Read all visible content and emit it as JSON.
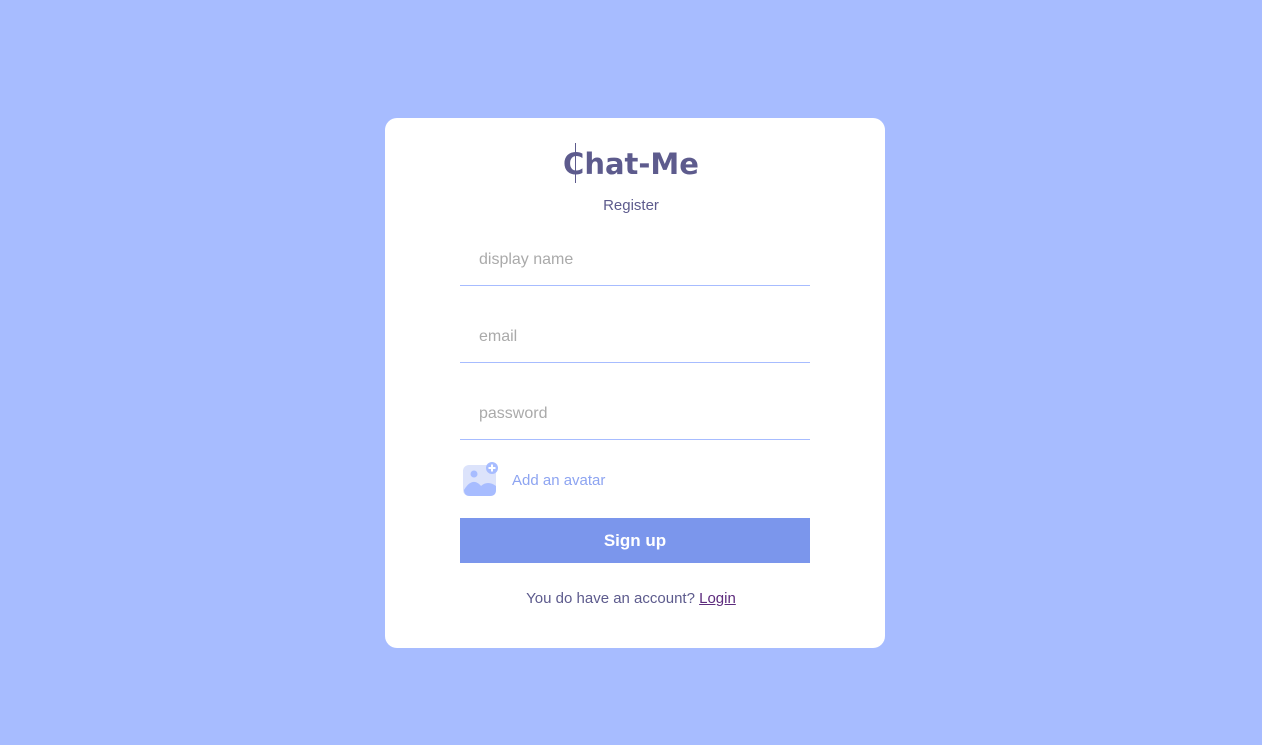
{
  "app": {
    "logo": "Chat-Me",
    "subtitle": "Register"
  },
  "form": {
    "display_name": {
      "placeholder": "display name",
      "value": ""
    },
    "email": {
      "placeholder": "email",
      "value": ""
    },
    "password": {
      "placeholder": "password",
      "value": ""
    },
    "avatar": {
      "icon": "add-image-icon",
      "label": "Add an avatar"
    },
    "submit_label": "Sign up"
  },
  "footer": {
    "prompt": "You do have an account?",
    "link_label": "Login"
  },
  "colors": {
    "background": "#a7bcff",
    "card": "#ffffff",
    "brand_text": "#5d5b8d",
    "button": "#7b96ec",
    "link": "#5d2b7d"
  }
}
